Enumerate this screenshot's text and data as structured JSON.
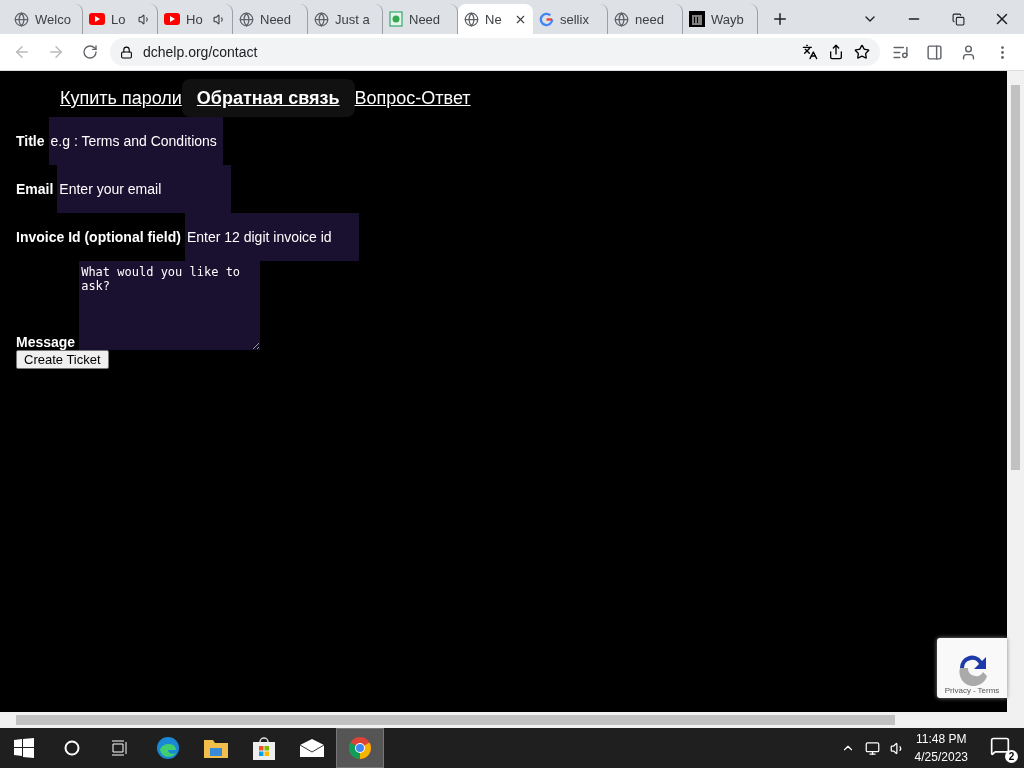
{
  "browser": {
    "tabs": [
      {
        "label": "Welco",
        "kind": "globe",
        "audio": false,
        "selected": false
      },
      {
        "label": "Lo",
        "kind": "video",
        "audio": true,
        "selected": false
      },
      {
        "label": "Ho",
        "kind": "video",
        "audio": true,
        "selected": false
      },
      {
        "label": "Need",
        "kind": "globe",
        "audio": false,
        "selected": false
      },
      {
        "label": "Just a",
        "kind": "globe",
        "audio": false,
        "selected": false
      },
      {
        "label": "Need",
        "kind": "sheet",
        "audio": false,
        "selected": false
      },
      {
        "label": "Ne",
        "kind": "globe",
        "audio": false,
        "selected": true
      },
      {
        "label": "sellix",
        "kind": "letter",
        "audio": false,
        "selected": false
      },
      {
        "label": "need",
        "kind": "globe",
        "audio": false,
        "selected": false
      },
      {
        "label": "Wayb",
        "kind": "columns",
        "audio": false,
        "selected": false
      }
    ],
    "address": "dchelp.org/contact"
  },
  "page": {
    "nav": [
      {
        "label": "Купить пароли",
        "selected": false
      },
      {
        "label": "Обратная связь",
        "selected": true
      },
      {
        "label": "Вопрос-Ответ",
        "selected": false
      }
    ],
    "fields": [
      {
        "label": "Title",
        "placeholder": "e.g : Terms and Conditions"
      },
      {
        "label": "Email",
        "placeholder": "Enter your email"
      },
      {
        "label": "Invoice Id (optional field)",
        "placeholder": "Enter 12 digit invoice id"
      }
    ],
    "message": {
      "label": "Message",
      "placeholder": "What would you like to ask?"
    },
    "submit": "Create Ticket",
    "recaptcha": {
      "links": [
        "Privacy",
        "Terms"
      ],
      "separator": "-"
    }
  },
  "taskbar": {
    "apps": [
      {
        "kind": "start",
        "selected": false
      },
      {
        "kind": "search",
        "selected": false
      },
      {
        "kind": "tasks",
        "selected": false
      },
      {
        "kind": "edge",
        "selected": false
      },
      {
        "kind": "folder",
        "selected": false
      },
      {
        "kind": "store",
        "selected": false
      },
      {
        "kind": "mail",
        "selected": false
      },
      {
        "kind": "chrome",
        "selected": true
      }
    ],
    "time": "11:48 PM",
    "date": "4/25/2023",
    "notifications": "2"
  }
}
